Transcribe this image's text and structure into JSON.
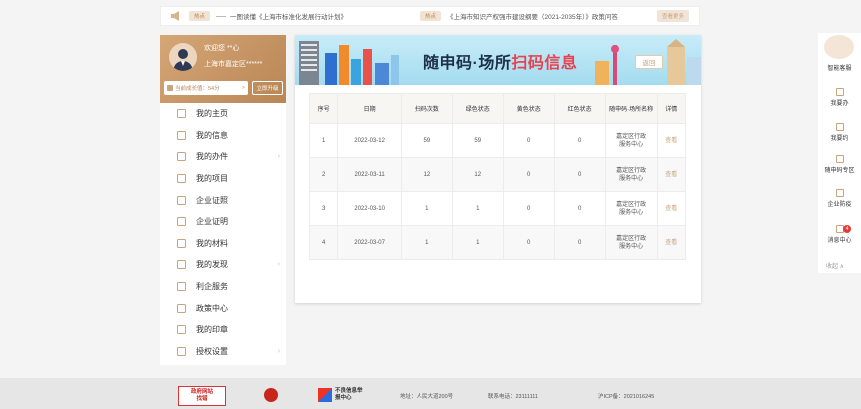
{
  "notice": {
    "tag1": "热点",
    "text1": "一图读懂《上海市标准化发展行动计划》",
    "tag2": "热点",
    "text2": "《上海市知识产权强市建设纲要（2021-2035年）》政策问答",
    "more": "查看更多"
  },
  "profile": {
    "greeting": "欢迎您 **心",
    "district": "上海市嘉定区******",
    "growth": "当前成长值：54分",
    "growth_arrow": ">",
    "upgrade": "立即升级"
  },
  "menu": [
    {
      "label": "我的主页",
      "icon": "home-icon",
      "chevron": ""
    },
    {
      "label": "我的信息",
      "icon": "user-icon",
      "chevron": ""
    },
    {
      "label": "我的办件",
      "icon": "list-icon",
      "chevron": "›"
    },
    {
      "label": "我的项目",
      "icon": "folder-icon",
      "chevron": ""
    },
    {
      "label": "企业证照",
      "icon": "license-icon",
      "chevron": ""
    },
    {
      "label": "企业证明",
      "icon": "certificate-icon",
      "chevron": ""
    },
    {
      "label": "我的材料",
      "icon": "document-icon",
      "chevron": ""
    },
    {
      "label": "我的发现",
      "icon": "discover-icon",
      "chevron": "›"
    },
    {
      "label": "利企服务",
      "icon": "heart-icon",
      "chevron": ""
    },
    {
      "label": "政策中心",
      "icon": "policy-icon",
      "chevron": ""
    },
    {
      "label": "我的印章",
      "icon": "seal-icon",
      "chevron": ""
    },
    {
      "label": "授权设置",
      "icon": "settings-icon",
      "chevron": "›"
    }
  ],
  "banner": {
    "title_main": "随申码·场所",
    "title_highlight": "扫码信息",
    "back": "返回"
  },
  "table": {
    "headers": [
      "序号",
      "日期",
      "扫码次数",
      "绿色状态",
      "黄色状态",
      "红色状态",
      "随申码·场所名称",
      "详情"
    ],
    "rows": [
      {
        "no": "1",
        "date": "2022-03-12",
        "scans": "59",
        "green": "59",
        "yellow": "0",
        "red": "0",
        "place": "嘉定区行政服务中心",
        "detail": "查看"
      },
      {
        "no": "2",
        "date": "2022-03-11",
        "scans": "12",
        "green": "12",
        "yellow": "0",
        "red": "0",
        "place": "嘉定区行政服务中心",
        "detail": "查看"
      },
      {
        "no": "3",
        "date": "2022-03-10",
        "scans": "1",
        "green": "1",
        "yellow": "0",
        "red": "0",
        "place": "嘉定区行政服务中心",
        "detail": "查看"
      },
      {
        "no": "4",
        "date": "2022-03-07",
        "scans": "1",
        "green": "1",
        "yellow": "0",
        "red": "0",
        "place": "嘉定区行政服务中心",
        "detail": "查看"
      }
    ]
  },
  "rightbar": {
    "items": [
      "智能客服",
      "我要办",
      "我要约",
      "随申码专区",
      "企业防疫",
      "消息中心"
    ],
    "badge": "4",
    "collapse": "收起 ∧"
  },
  "footer": {
    "logo1_line1": "政府网站",
    "logo1_line2": "找错",
    "logo3": "不良信息举报中心",
    "address": "地址：人民大道200号",
    "phone": "联系电话：23111111",
    "icp": "沪ICP备：2021016245"
  },
  "colors": {
    "accent": "#c9a47c",
    "profile_bg": "#c99a6a",
    "highlight_red": "#e8414f"
  }
}
